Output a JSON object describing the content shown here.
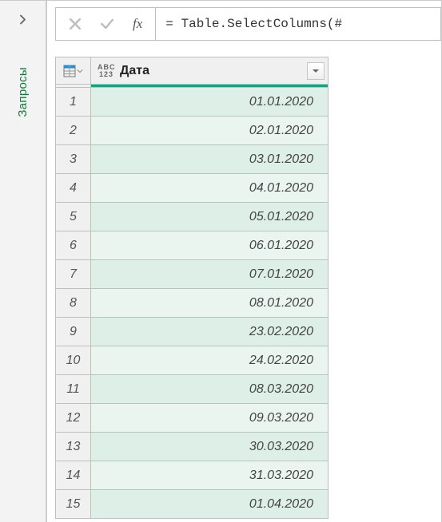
{
  "sidebar": {
    "label": "Запросы"
  },
  "formula_bar": {
    "fx_label": "fx",
    "formula": "= Table.SelectColumns(#"
  },
  "table": {
    "columns": [
      {
        "name": "Дата",
        "type_label_top": "ABC",
        "type_label_bottom": "123"
      }
    ],
    "rows": [
      {
        "n": "1",
        "value": "01.01.2020"
      },
      {
        "n": "2",
        "value": "02.01.2020"
      },
      {
        "n": "3",
        "value": "03.01.2020"
      },
      {
        "n": "4",
        "value": "04.01.2020"
      },
      {
        "n": "5",
        "value": "05.01.2020"
      },
      {
        "n": "6",
        "value": "06.01.2020"
      },
      {
        "n": "7",
        "value": "07.01.2020"
      },
      {
        "n": "8",
        "value": "08.01.2020"
      },
      {
        "n": "9",
        "value": "23.02.2020"
      },
      {
        "n": "10",
        "value": "24.02.2020"
      },
      {
        "n": "11",
        "value": "08.03.2020"
      },
      {
        "n": "12",
        "value": "09.03.2020"
      },
      {
        "n": "13",
        "value": "30.03.2020"
      },
      {
        "n": "14",
        "value": "31.03.2020"
      },
      {
        "n": "15",
        "value": "01.04.2020"
      }
    ]
  }
}
